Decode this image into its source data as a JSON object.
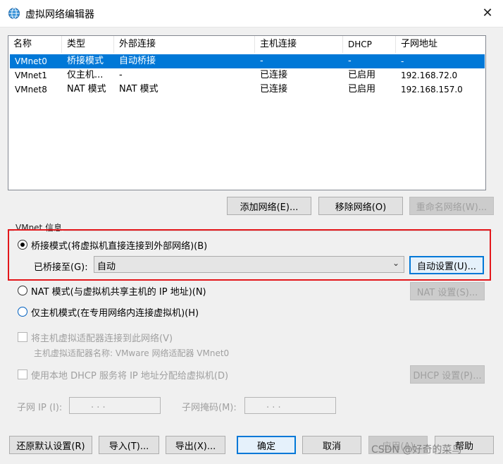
{
  "window": {
    "title": "虚拟网络编辑器",
    "icon": "network-globe-icon",
    "close_glyph": "✕"
  },
  "network_list": {
    "columns": [
      "名称",
      "类型",
      "外部连接",
      "主机连接",
      "DHCP",
      "子网地址"
    ],
    "rows": [
      {
        "name": "VMnet0",
        "type": "桥接模式",
        "external": "自动桥接",
        "host": "-",
        "dhcp": "-",
        "subnet": "-",
        "selected": true
      },
      {
        "name": "VMnet1",
        "type": "仅主机...",
        "external": "-",
        "host": "已连接",
        "dhcp": "已启用",
        "subnet": "192.168.72.0",
        "selected": false
      },
      {
        "name": "VMnet8",
        "type": "NAT 模式",
        "external": "NAT 模式",
        "host": "已连接",
        "dhcp": "已启用",
        "subnet": "192.168.157.0",
        "selected": false
      }
    ]
  },
  "list_buttons": {
    "add": "添加网络(E)...",
    "remove": "移除网络(O)",
    "rename": "重命名网络(W)..."
  },
  "vmnet_info": {
    "group_label": "VMnet 信息",
    "bridged_radio": "桥接模式(将虚拟机直接连接到外部网络)(B)",
    "bridged_to_label": "已桥接至(G):",
    "bridged_to_value": "自动",
    "auto_settings_button": "自动设置(U)...",
    "nat_radio": "NAT 模式(与虚拟机共享主机的 IP 地址)(N)",
    "nat_settings_button": "NAT 设置(S)...",
    "host_only_radio": "仅主机模式(在专用网络内连接虚拟机)(H)",
    "connect_adapter_check": "将主机虚拟适配器连接到此网络(V)",
    "adapter_name_text": "主机虚拟适配器名称: VMware 网络适配器 VMnet0",
    "dhcp_check": "使用本地 DHCP 服务将 IP 地址分配给虚拟机(D)",
    "dhcp_settings_button": "DHCP 设置(P)...",
    "subnet_ip_label": "子网 IP (I):",
    "subnet_mask_label": "子网掩码(M):",
    "ip_dots": ".      .      ."
  },
  "bottom_buttons": {
    "restore": "还原默认设置(R)",
    "import": "导入(T)...",
    "export": "导出(X)...",
    "ok": "确定",
    "cancel": "取消",
    "apply": "应用(A)",
    "help": "帮助"
  },
  "watermark": "CSDN @好奇的菜鸟",
  "colors": {
    "selection": "#0078d7",
    "highlight_box": "#e3161a",
    "dialog_bg": "#f0f0f0"
  }
}
